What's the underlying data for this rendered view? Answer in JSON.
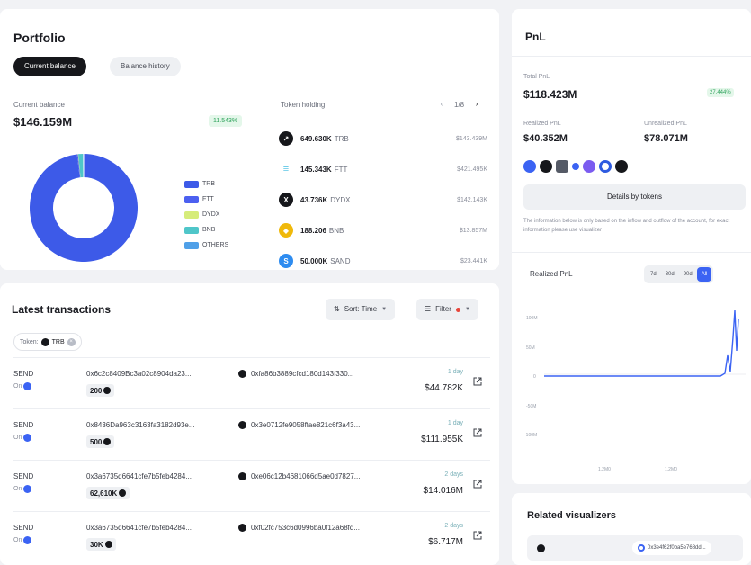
{
  "portfolio": {
    "title": "Portfolio",
    "tabs": [
      "Current balance",
      "Balance history"
    ],
    "current_balance_label": "Current balance",
    "current_balance_value": "$146.159M",
    "change_badge": "11.543%",
    "legend": [
      {
        "label": "TRB",
        "color": "#3d5ae8"
      },
      {
        "label": "FTT",
        "color": "#4c60f0"
      },
      {
        "label": "DYDX",
        "color": "#d6ec7a"
      },
      {
        "label": "BNB",
        "color": "#4fc6c9"
      },
      {
        "label": "OTHERS",
        "color": "#4fa0e8"
      }
    ],
    "token_holding_label": "Token holding",
    "pager": {
      "current": "1/8"
    },
    "tokens": [
      {
        "amount": "649.630K",
        "symbol": "TRB",
        "value": "$143.439M",
        "icon_color": "#16171b",
        "icon": "trb-token-icon"
      },
      {
        "amount": "145.343K",
        "symbol": "FTT",
        "value": "$421.495K",
        "icon_color": "#5fc7e6",
        "icon": "ftt-token-icon"
      },
      {
        "amount": "43.736K",
        "symbol": "DYDX",
        "value": "$142.143K",
        "icon_color": "#16171b",
        "icon": "dydx-token-icon"
      },
      {
        "amount": "188.206",
        "symbol": "BNB",
        "value": "$13.857M",
        "icon_color": "#f0b90b",
        "icon": "bnb-token-icon"
      },
      {
        "amount": "50.000K",
        "symbol": "SAND",
        "value": "$23.441K",
        "icon_color": "#2e8cf0",
        "icon": "sand-token-icon"
      }
    ]
  },
  "chart_data": {
    "type": "pie",
    "categories": [
      "TRB",
      "FTT",
      "DYDX",
      "BNB",
      "OTHERS"
    ],
    "values": [
      98.0,
      0.3,
      0.1,
      1.4,
      0.2
    ],
    "colors": [
      "#3d5ae8",
      "#4c60f0",
      "#d6ec7a",
      "#4fc6c9",
      "#4fa0e8"
    ],
    "legend": "right"
  },
  "pnl": {
    "title": "PnL",
    "total_label": "Total PnL",
    "total_value": "$118.423M",
    "total_badge": "27.444%",
    "realized_label": "Realized PnL",
    "realized_value": "$40.352M",
    "unrealized_label": "Unrealized PnL",
    "unrealized_value": "$78.071M",
    "chain_icon_colors": [
      "#3b63f3",
      "#16171b",
      "#555a66",
      "#3b63f3",
      "#7b5cf0",
      "#2e5be0",
      "#16171b"
    ],
    "details_button": "Details by tokens",
    "info_text": "The information below is only based on the inflow and outflow of the account, for exact information please use visualizer",
    "realized_chart_label": "Realized PnL",
    "ranges": [
      "7d",
      "30d",
      "90d",
      "All"
    ],
    "active_range": "All",
    "chart": {
      "type": "line",
      "y_ticks": [
        "100M",
        "50M",
        "0",
        "-50M",
        "-100M"
      ],
      "x_ticks": [
        "1.2M0",
        "1.2M0"
      ],
      "color": "#3b63f3"
    }
  },
  "related": {
    "title": "Related visualizers",
    "pill_text": "0x3e4f62f0ba5e768dd..."
  },
  "transactions": {
    "title": "Latest transactions",
    "sort_label": "Sort: Time",
    "filter_label": "Filter",
    "chip_prefix": "Token:",
    "chip_token": "TRB",
    "rows": [
      {
        "type": "SEND",
        "chain": "On",
        "from": "0x6c2c8409Bc3a02c8904da23...",
        "amount": "200",
        "to": "0xfa86b3889cfcd180d143f330...",
        "time": "1 day",
        "value": "$44.782K"
      },
      {
        "type": "SEND",
        "chain": "On",
        "from": "0x8436Da963c3163fa3182d93e...",
        "amount": "500",
        "to": "0x3e0712fe9058ffae821c6f3a43...",
        "time": "1 day",
        "value": "$111.955K"
      },
      {
        "type": "SEND",
        "chain": "On",
        "from": "0x3a6735d6641cfe7b5feb4284...",
        "amount": "62,610K",
        "to": "0xe06c12b4681066d5ae0d7827...",
        "time": "2 days",
        "value": "$14.016M"
      },
      {
        "type": "SEND",
        "chain": "On",
        "from": "0x3a6735d6641cfe7b5feb4284...",
        "amount": "30K",
        "to": "0xf02fc753c6d0996ba0f12a68fd...",
        "time": "2 days",
        "value": "$6.717M"
      }
    ]
  }
}
